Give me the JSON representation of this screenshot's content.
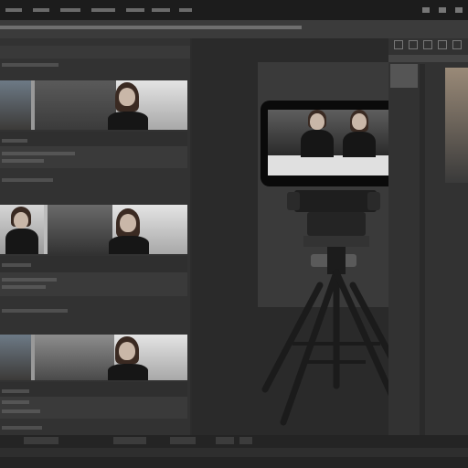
{
  "app": {
    "title": ""
  },
  "clips": [
    {
      "id": 1
    },
    {
      "id": 2
    },
    {
      "id": 3
    }
  ],
  "colors": {
    "background": "#2c2c2c",
    "panel": "#3a3a3a",
    "monitor_bezel": "#0a0a0a",
    "camera_body": "#1e1e1e"
  },
  "icons": [
    "camera-icon",
    "tripod-icon",
    "window-control-icon"
  ]
}
